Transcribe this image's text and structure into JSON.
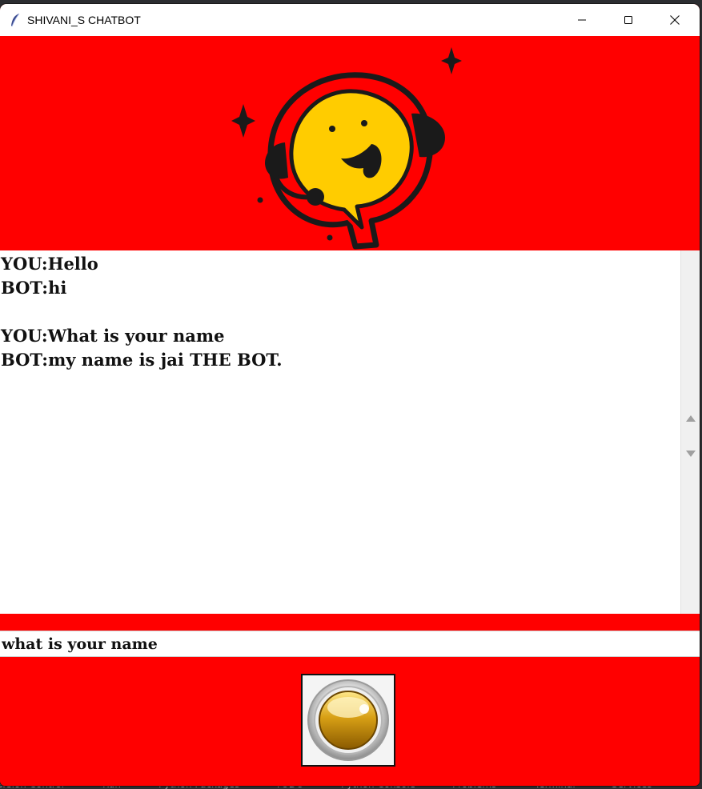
{
  "window": {
    "title": "SHIVANI_S CHATBOT",
    "controls": {
      "minimize": "minimize-icon",
      "maximize": "maximize-icon",
      "close": "close-icon"
    }
  },
  "banner": {
    "image": "headset-smiley-chat-mascot",
    "background_color": "#ff0000"
  },
  "chat": {
    "lines": [
      "YOU:Hello",
      "BOT:hi",
      "",
      "YOU:What is your name",
      "BOT:my name is jai THE BOT."
    ]
  },
  "input": {
    "value": "what is your name"
  },
  "send_button": {
    "icon": "gold-orb-button-icon"
  },
  "colors": {
    "accent": "#ff0000",
    "mascot_face": "#ffcc00",
    "text": "#111111"
  },
  "background_app": {
    "tabs": [
      "ersion Control",
      "Run",
      "Python Packages",
      "TODO",
      "Python Console",
      "Problems",
      "Terminal",
      "Services"
    ]
  }
}
